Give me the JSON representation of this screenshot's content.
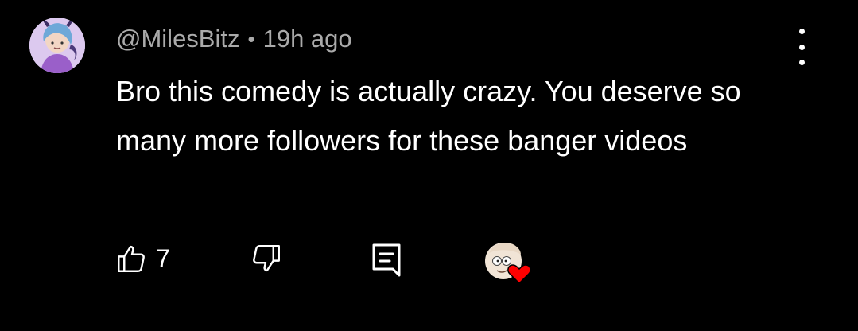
{
  "comment": {
    "author": "@MilesBitz",
    "separator": "•",
    "time_ago": "19h ago",
    "text": "Bro this comedy is actually crazy. You deserve so many more followers for these banger videos",
    "like_count": "7"
  },
  "icons": {
    "more": "more-vertical-icon",
    "like": "thumbs-up-icon",
    "dislike": "thumbs-down-icon",
    "reply": "reply-comment-icon",
    "creator_heart": "creator-heart-icon"
  },
  "colors": {
    "background": "#000000",
    "text_primary": "#ffffff",
    "text_secondary": "#aaaaaa",
    "heart": "#ff0000"
  }
}
